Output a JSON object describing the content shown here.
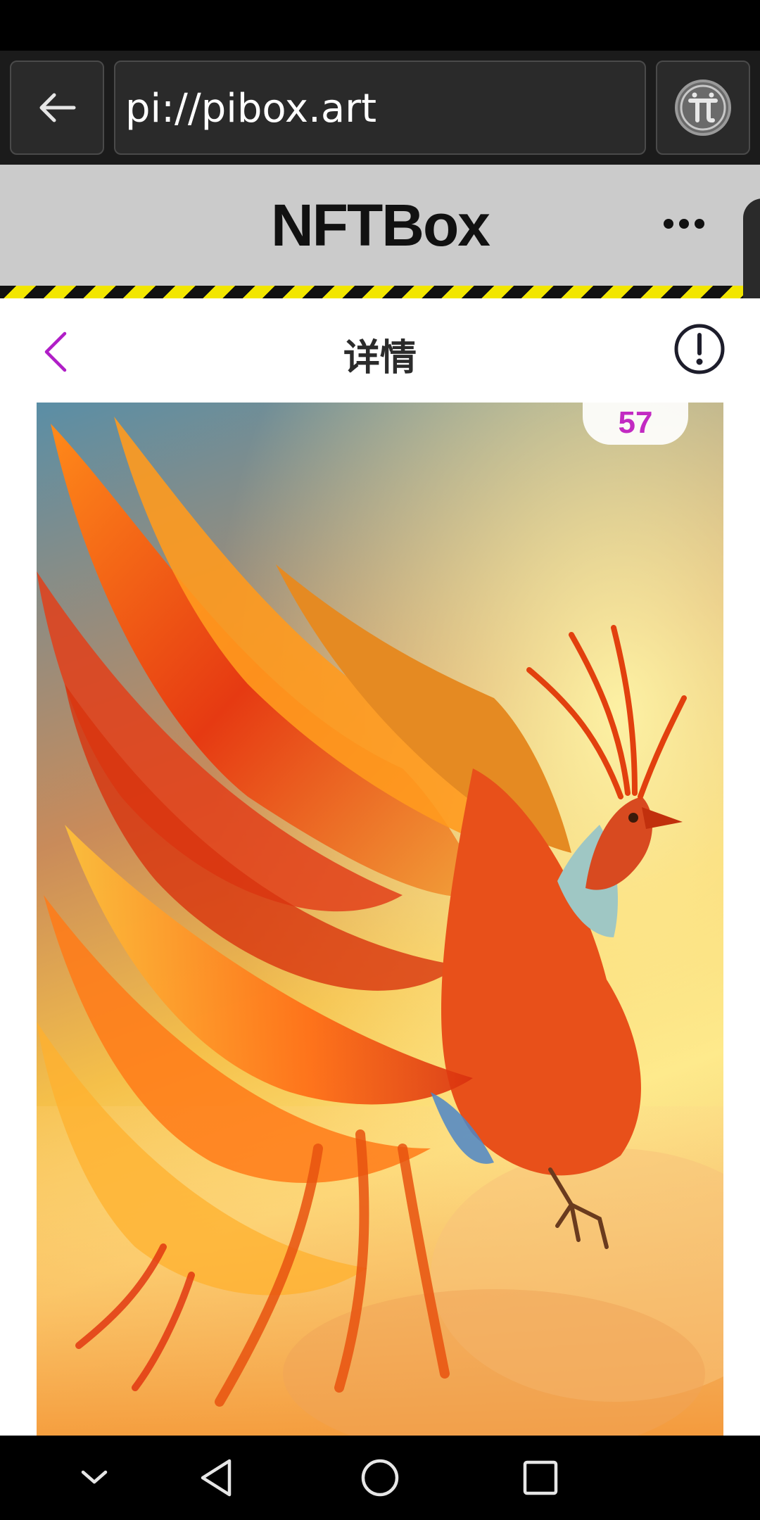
{
  "browser": {
    "url": "pi://pibox.art",
    "back_icon": "arrow-left-icon",
    "pi_icon": "pi-logo-icon"
  },
  "app": {
    "title": "NFTBox",
    "menu_icon": "more-horizontal-icon"
  },
  "page": {
    "title": "详情",
    "back_icon": "chevron-left-icon",
    "info_icon": "info-circle-icon",
    "accent_color": "#b01ec7"
  },
  "artwork": {
    "count": "57",
    "description_icon": "phoenix-artwork"
  },
  "system_nav": {
    "items": [
      "hide-keyboard-icon",
      "back-triangle-icon",
      "home-circle-icon",
      "recents-square-icon"
    ]
  }
}
